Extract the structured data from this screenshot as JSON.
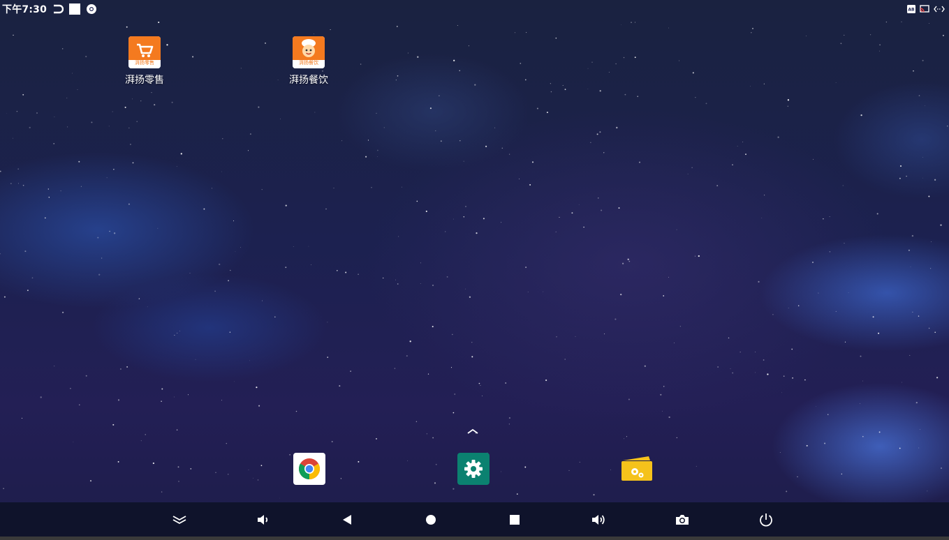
{
  "status_bar": {
    "time": "下午7:30",
    "left_icons": [
      "return-notification-icon",
      "square-notification-icon",
      "chrome-notification-icon"
    ],
    "right_icons": [
      "keyboard-badge-icon",
      "cast-icon",
      "network-transfer-icon"
    ]
  },
  "desktop": {
    "shortcuts": [
      {
        "label": "湃扬零售",
        "icon": "cart-app-icon",
        "tile_text": "湃扬零售",
        "color": "#f47a1f"
      },
      {
        "label": "湃扬餐饮",
        "icon": "chef-app-icon",
        "tile_text": "湃扬餐饮",
        "color": "#f47a1f"
      }
    ]
  },
  "dock": {
    "drawer_handle_icon": "chevron-up-icon",
    "apps": [
      {
        "name": "chrome",
        "icon": "chrome-icon"
      },
      {
        "name": "settings",
        "icon": "gear-icon",
        "color": "#0b8170"
      },
      {
        "name": "device-settings",
        "icon": "folder-gear-icon",
        "color": "#f5c21b"
      }
    ]
  },
  "nav_bar": {
    "buttons": [
      {
        "name": "collapse",
        "icon": "double-chevron-down-icon"
      },
      {
        "name": "volume-down",
        "icon": "volume-down-icon"
      },
      {
        "name": "back",
        "icon": "back-triangle-icon"
      },
      {
        "name": "home",
        "icon": "home-circle-icon"
      },
      {
        "name": "recents",
        "icon": "recents-square-icon"
      },
      {
        "name": "volume-up",
        "icon": "volume-up-icon"
      },
      {
        "name": "screenshot",
        "icon": "camera-icon"
      },
      {
        "name": "power",
        "icon": "power-icon"
      }
    ]
  }
}
